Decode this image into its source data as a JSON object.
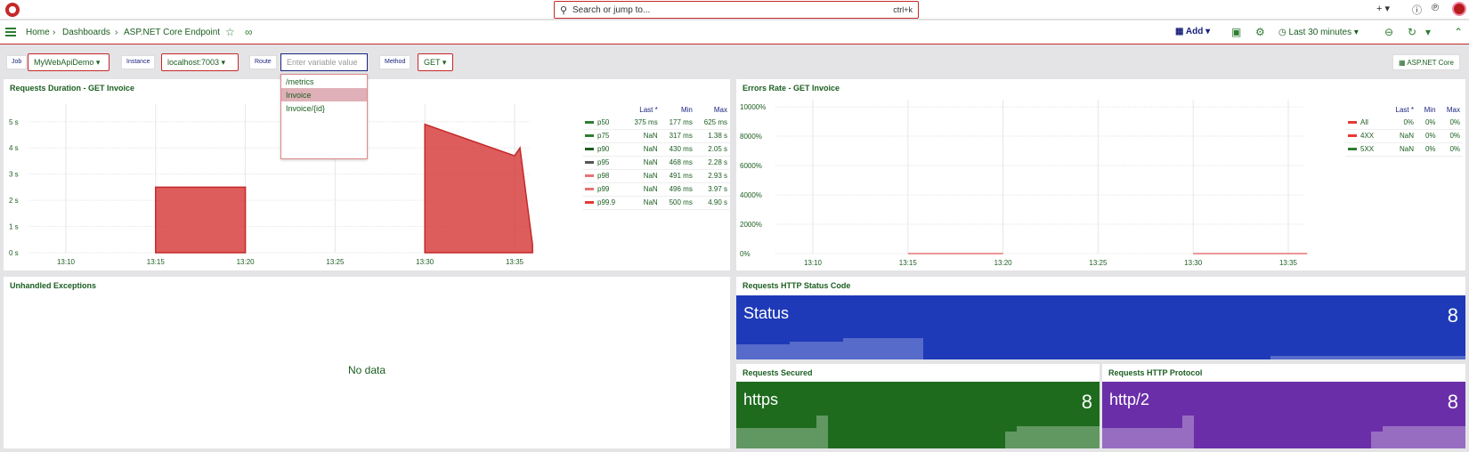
{
  "topbar": {
    "search_placeholder": "Search or jump to...",
    "shortcut": "ctrl+k",
    "plus_label": "+"
  },
  "breadcrumb": {
    "home": "Home",
    "dashboards": "Dashboards",
    "current": "ASP.NET Core Endpoint"
  },
  "toolbar": {
    "add_label": "Add",
    "time_range": "Last 30 minutes"
  },
  "variables": {
    "job": {
      "label": "Job",
      "value": "MyWebApiDemo"
    },
    "instance": {
      "label": "Instance",
      "value": "localhost:7003"
    },
    "route": {
      "label": "Route",
      "placeholder": "Enter variable value",
      "options": [
        "/metrics",
        "Invoice",
        "Invoice/{id}"
      ],
      "highlighted": "Invoice"
    },
    "method": {
      "label": "Method",
      "value": "GET"
    },
    "link_label": "ASP.NET Core"
  },
  "panels": {
    "duration": {
      "title": "Requests Duration - GET Invoice",
      "legend_headers": [
        "Last *",
        "Min",
        "Max"
      ],
      "legend": [
        {
          "name": "p50",
          "color": "#2e7d32",
          "last": "375 ms",
          "min": "177 ms",
          "max": "625 ms"
        },
        {
          "name": "p75",
          "color": "#2e7d32",
          "last": "NaN",
          "min": "317 ms",
          "max": "1.38 s"
        },
        {
          "name": "p90",
          "color": "#1b5e20",
          "last": "NaN",
          "min": "430 ms",
          "max": "2.05 s"
        },
        {
          "name": "p95",
          "color": "#555555",
          "last": "NaN",
          "min": "468 ms",
          "max": "2.28 s"
        },
        {
          "name": "p98",
          "color": "#e57373",
          "last": "NaN",
          "min": "491 ms",
          "max": "2.93 s"
        },
        {
          "name": "p99",
          "color": "#e57373",
          "last": "NaN",
          "min": "496 ms",
          "max": "3.97 s"
        },
        {
          "name": "p99.9",
          "color": "#e53935",
          "last": "NaN",
          "min": "500 ms",
          "max": "4.90 s"
        }
      ]
    },
    "errors": {
      "title": "Errors Rate - GET Invoice",
      "legend_headers": [
        "Last *",
        "Min",
        "Max"
      ],
      "legend": [
        {
          "name": "All",
          "color": "#e53935",
          "last": "0%",
          "min": "0%",
          "max": "0%"
        },
        {
          "name": "4XX",
          "color": "#e53935",
          "last": "NaN",
          "min": "0%",
          "max": "0%"
        },
        {
          "name": "5XX",
          "color": "#2e7d32",
          "last": "NaN",
          "min": "0%",
          "max": "0%"
        }
      ]
    },
    "exceptions": {
      "title": "Unhandled Exceptions",
      "no_data": "No data"
    },
    "status_code": {
      "title": "Requests HTTP Status Code",
      "label": "Status",
      "value": "8",
      "color": "#1e3ab8"
    },
    "secured": {
      "title": "Requests Secured",
      "label": "https",
      "value": "8",
      "color": "#1e6b1e"
    },
    "protocol": {
      "title": "Requests HTTP Protocol",
      "label": "http/2",
      "value": "8",
      "color": "#6a2fa8"
    }
  },
  "chart_data": [
    {
      "type": "area",
      "title": "Requests Duration - GET Invoice",
      "x_ticks": [
        "13:10",
        "13:15",
        "13:20",
        "13:25",
        "13:30",
        "13:35"
      ],
      "y_ticks": [
        "0 s",
        "1 s",
        "2 s",
        "3 s",
        "4 s",
        "5 s"
      ],
      "ylim": [
        0,
        5.4
      ],
      "series": [
        {
          "name": "p99.9",
          "segments": [
            {
              "x": [
                "13:15",
                "13:20"
              ],
              "y": [
                2.5,
                2.5
              ]
            },
            {
              "x": [
                "13:30",
                "13:35",
                "13:35.3",
                "13:36"
              ],
              "y": [
                4.9,
                3.7,
                4.0,
                0.3
              ]
            }
          ]
        }
      ]
    },
    {
      "type": "line",
      "title": "Errors Rate - GET Invoice",
      "x_ticks": [
        "13:10",
        "13:15",
        "13:20",
        "13:25",
        "13:30",
        "13:35"
      ],
      "y_ticks": [
        "0%",
        "2000%",
        "4000%",
        "6000%",
        "8000%",
        "10000%"
      ],
      "ylim": [
        0,
        10000
      ],
      "series": [
        {
          "name": "All",
          "segments": [
            {
              "x": [
                "13:15",
                "13:20"
              ],
              "y": [
                0,
                0
              ]
            },
            {
              "x": [
                "13:30",
                "13:36"
              ],
              "y": [
                0,
                0
              ]
            }
          ]
        }
      ]
    }
  ]
}
